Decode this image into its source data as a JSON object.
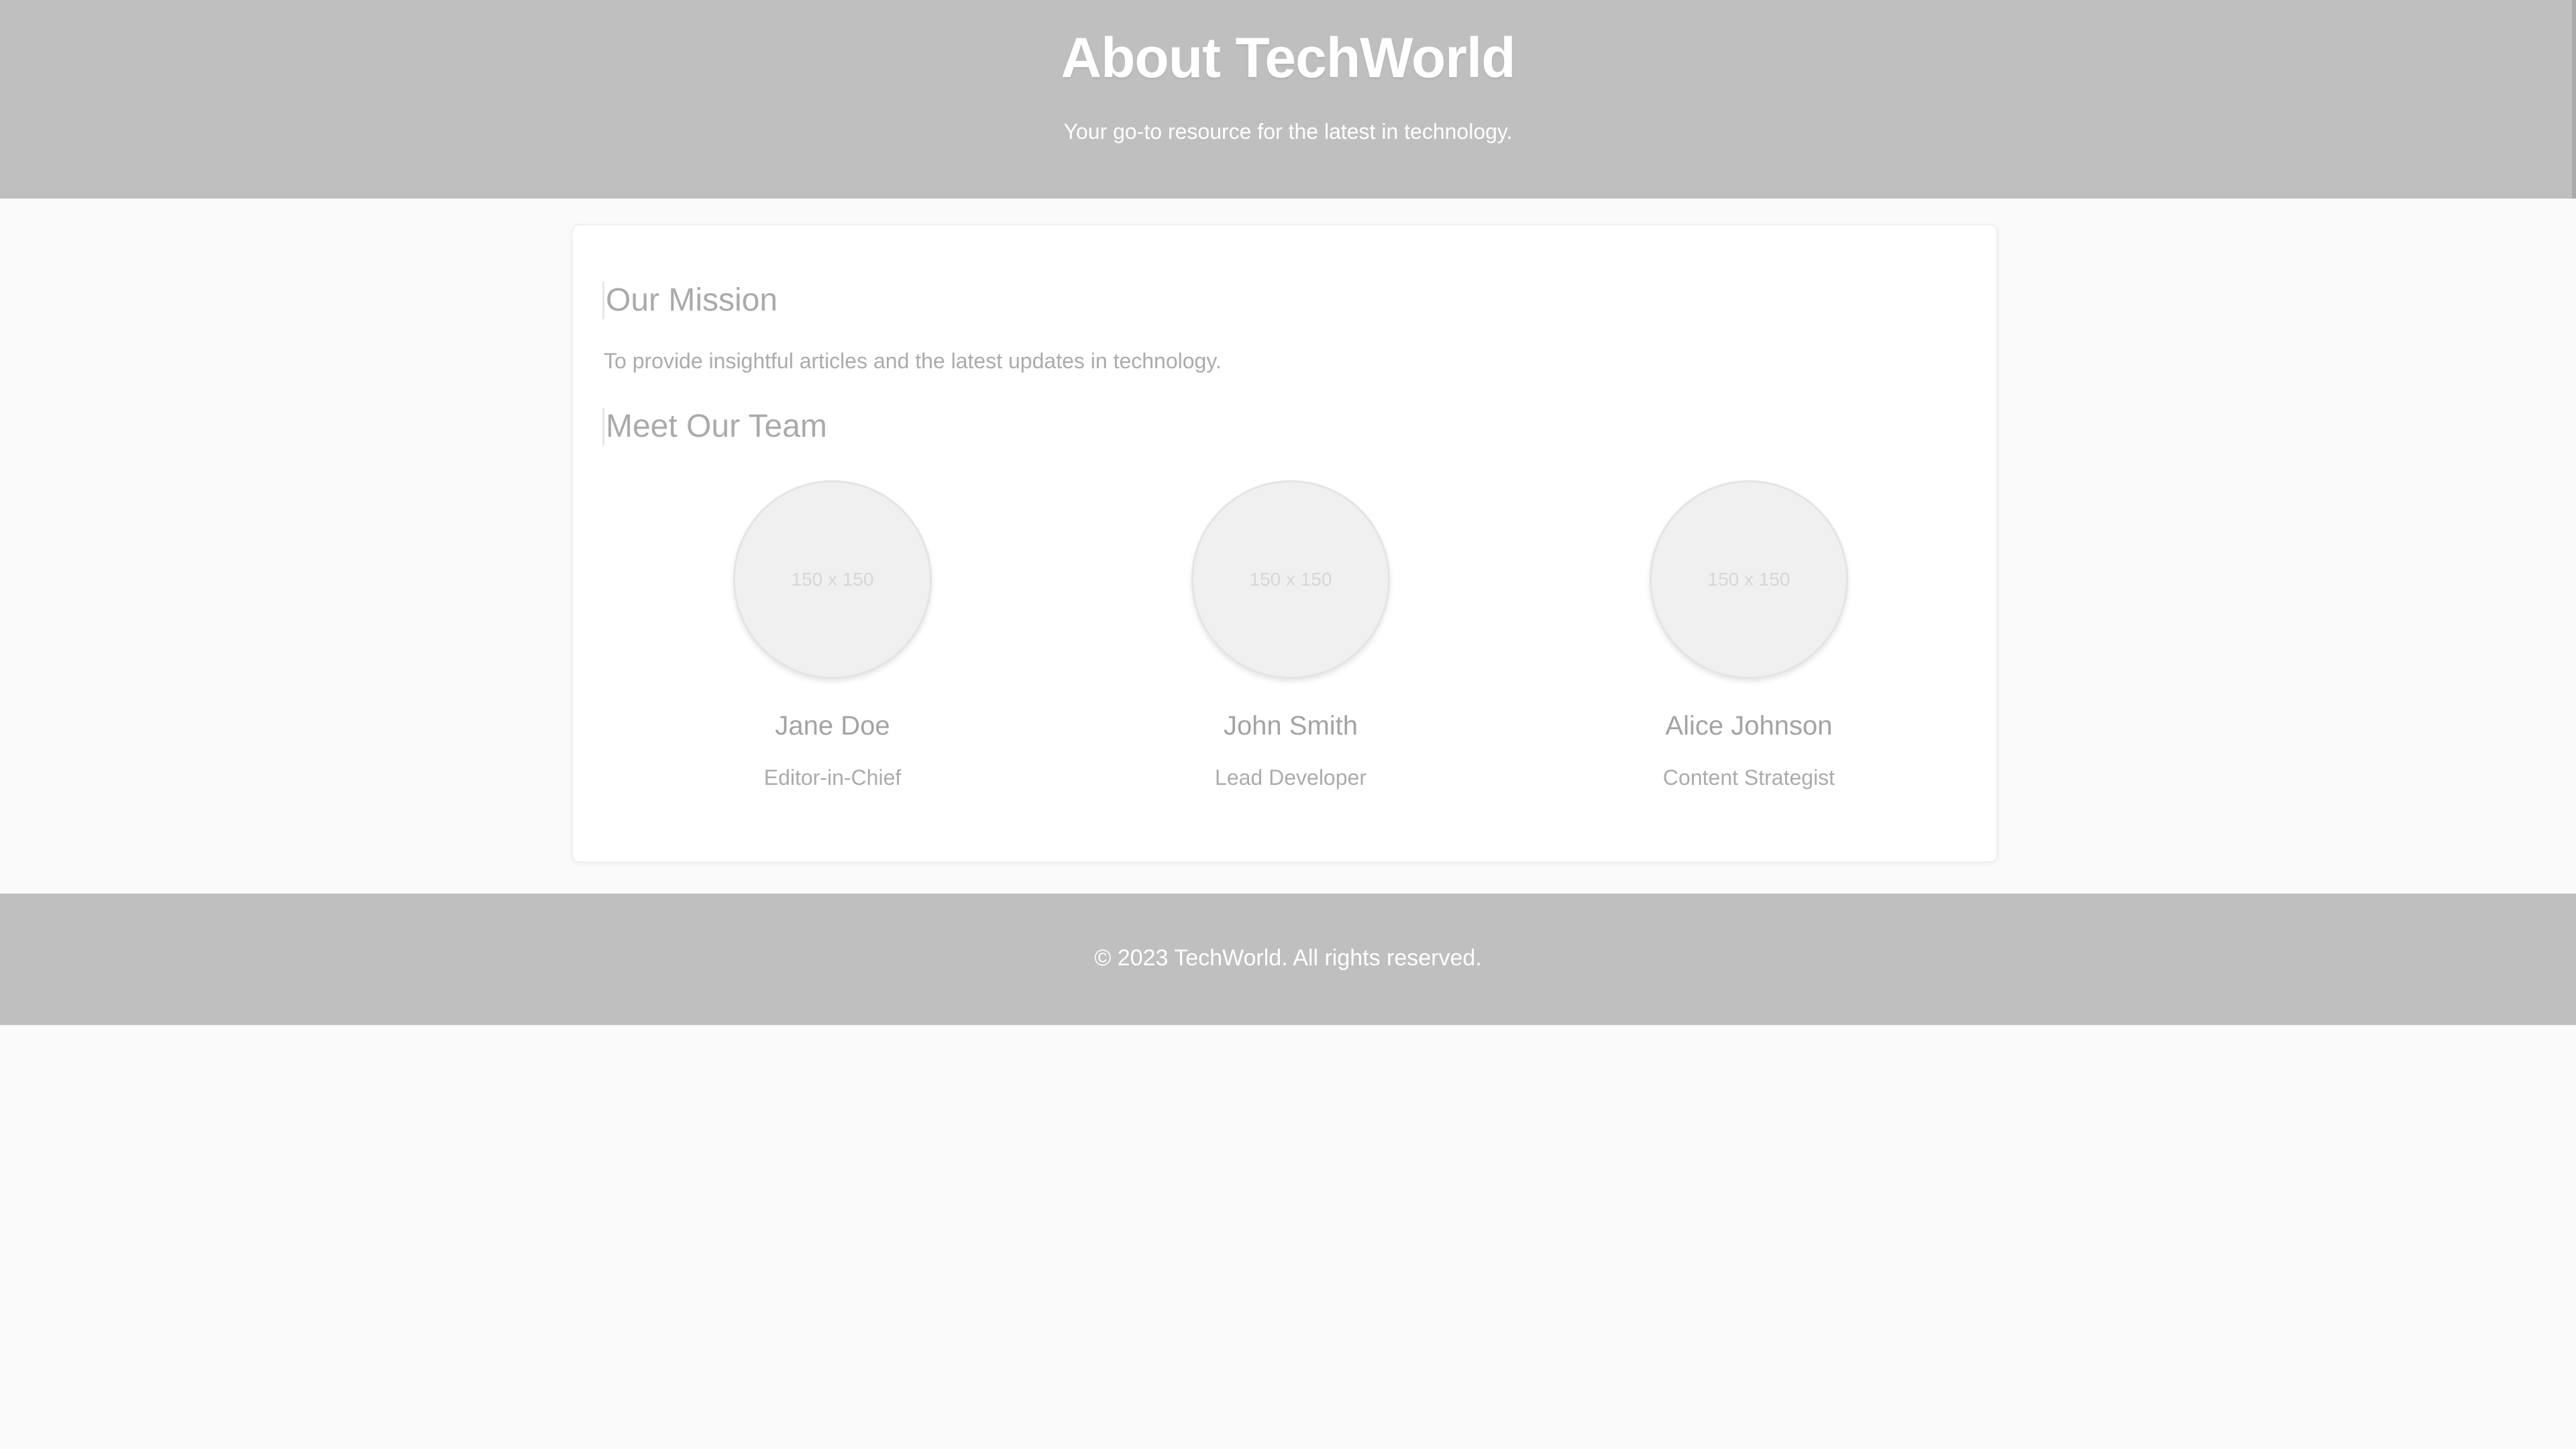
{
  "header": {
    "title": "About TechWorld",
    "tagline": "Your go-to resource for the latest in technology."
  },
  "mission": {
    "heading": "Our Mission",
    "text": "To provide insightful articles and the latest updates in technology."
  },
  "team": {
    "heading": "Meet Our Team",
    "members": [
      {
        "name": "Jane Doe",
        "role": "Editor-in-Chief",
        "avatar_placeholder": "150 x 150"
      },
      {
        "name": "John Smith",
        "role": "Lead Developer",
        "avatar_placeholder": "150 x 150"
      },
      {
        "name": "Alice Johnson",
        "role": "Content Strategist",
        "avatar_placeholder": "150 x 150"
      }
    ]
  },
  "footer": {
    "copyright": "© 2023 TechWorld. All rights reserved."
  },
  "colors": {
    "header_bg": "#bfbfbf",
    "page_bg": "#fafafa",
    "card_bg": "#ffffff",
    "heading_text": "#aaaaaa",
    "header_text": "#ffffff"
  }
}
